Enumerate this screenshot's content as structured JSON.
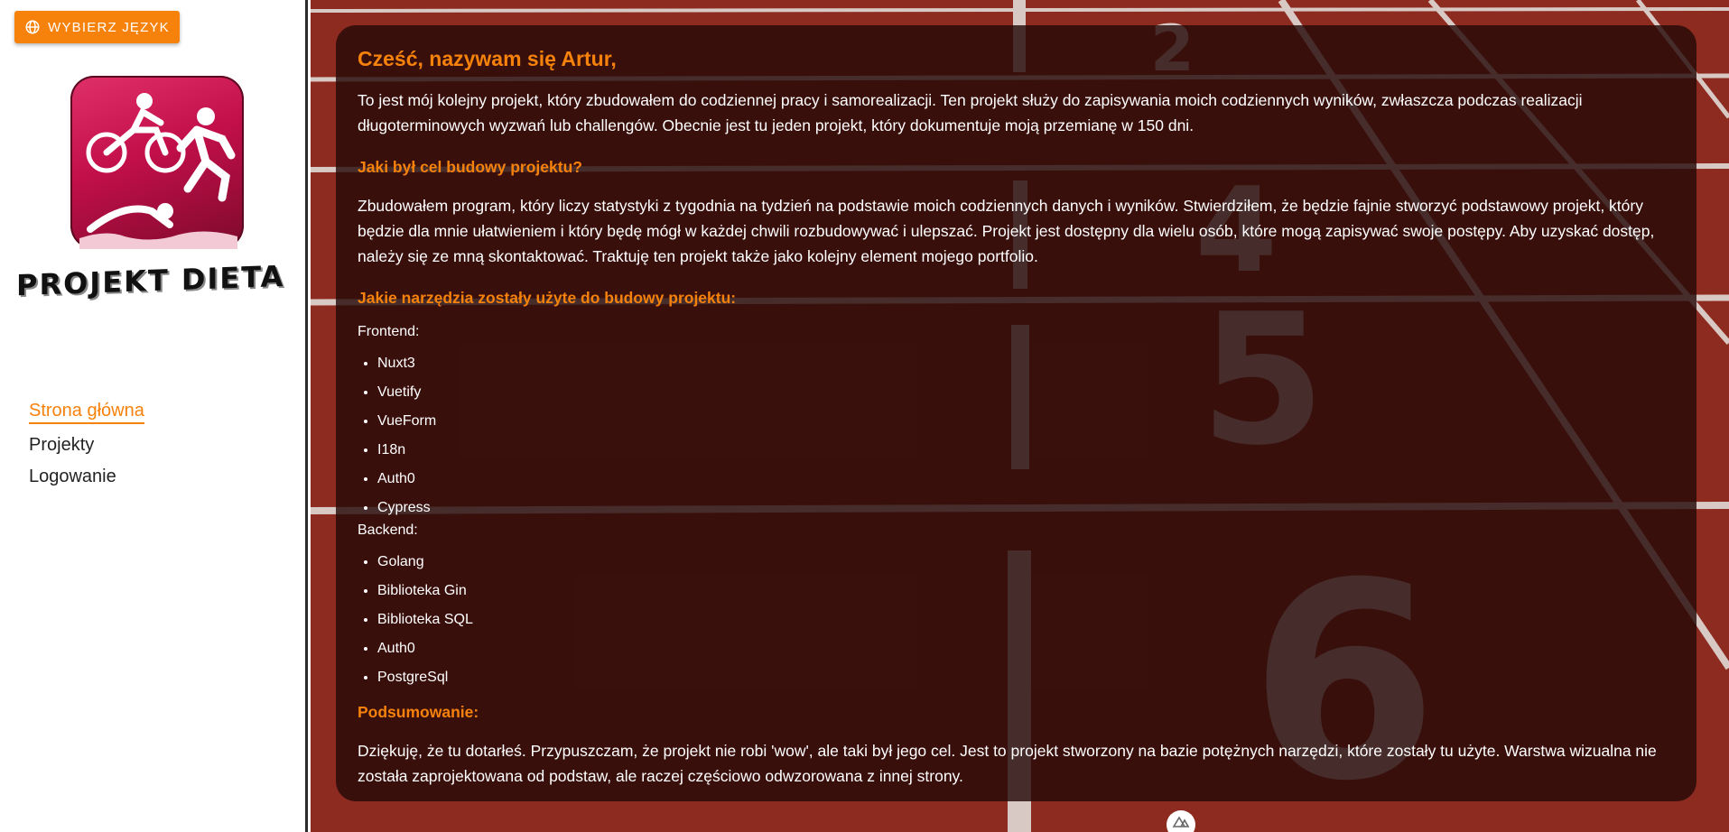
{
  "sidebar": {
    "language_button": "Wybierz język",
    "logo_text": "PROJEKT DIETA",
    "nav": [
      {
        "label": "Strona główna",
        "active": true
      },
      {
        "label": "Projekty",
        "active": false
      },
      {
        "label": "Logowanie",
        "active": false
      }
    ]
  },
  "main": {
    "heading": "Cześć, nazywam się Artur,",
    "intro": "To jest mój kolejny projekt, który zbudowałem do codziennej pracy i samorealizacji. Ten projekt służy do zapisywania moich codziennych wyników, zwłaszcza podczas realizacji długoterminowych wyzwań lub challengów. Obecnie jest tu jeden projekt, który dokumentuje moją przemianę w 150 dni.",
    "goal_heading": "Jaki był cel budowy projektu?",
    "goal_text": "Zbudowałem program, który liczy statystyki z tygodnia na tydzień na podstawie moich codziennych danych i wyników. Stwierdziłem, że będzie fajnie stworzyć podstawowy projekt, który będzie dla mnie ułatwieniem i który będę mógł w każdej chwili rozbudowywać i ulepszać. Projekt jest dostępny dla wielu osób, które mogą zapisywać swoje postępy. Aby uzyskać dostęp, należy się ze mną skontaktować. Traktuję ten projekt także jako kolejny element mojego portfolio.",
    "tools_heading": "Jakie narzędzia zostały użyte do budowy projektu:",
    "frontend_label": "Frontend:",
    "frontend": [
      "Nuxt3",
      "Vuetify",
      "VueForm",
      "I18n",
      "Auth0",
      "Cypress"
    ],
    "backend_label": "Backend:",
    "backend": [
      "Golang",
      "Biblioteka Gin",
      "Biblioteka SQL",
      "Auth0",
      "PostgreSql"
    ],
    "summary_heading": "Podsumowanie:",
    "summary_text": "Dziękuję, że tu dotarłeś. Przypuszczam, że projekt nie robi 'wow', ale taki był jego cel. Jest to projekt stworzony na bazie potężnych narzędzi, które zostały tu użyte. Warstwa wizualna nie została zaprojektowana od podstaw, ale raczej częściowo odwzorowana z innej strony."
  },
  "background": {
    "lane_numbers": [
      "2",
      "4",
      "5",
      "6"
    ]
  },
  "colors": {
    "accent": "#f6820c",
    "track": "#8c2a1e",
    "card": "#260a08"
  }
}
